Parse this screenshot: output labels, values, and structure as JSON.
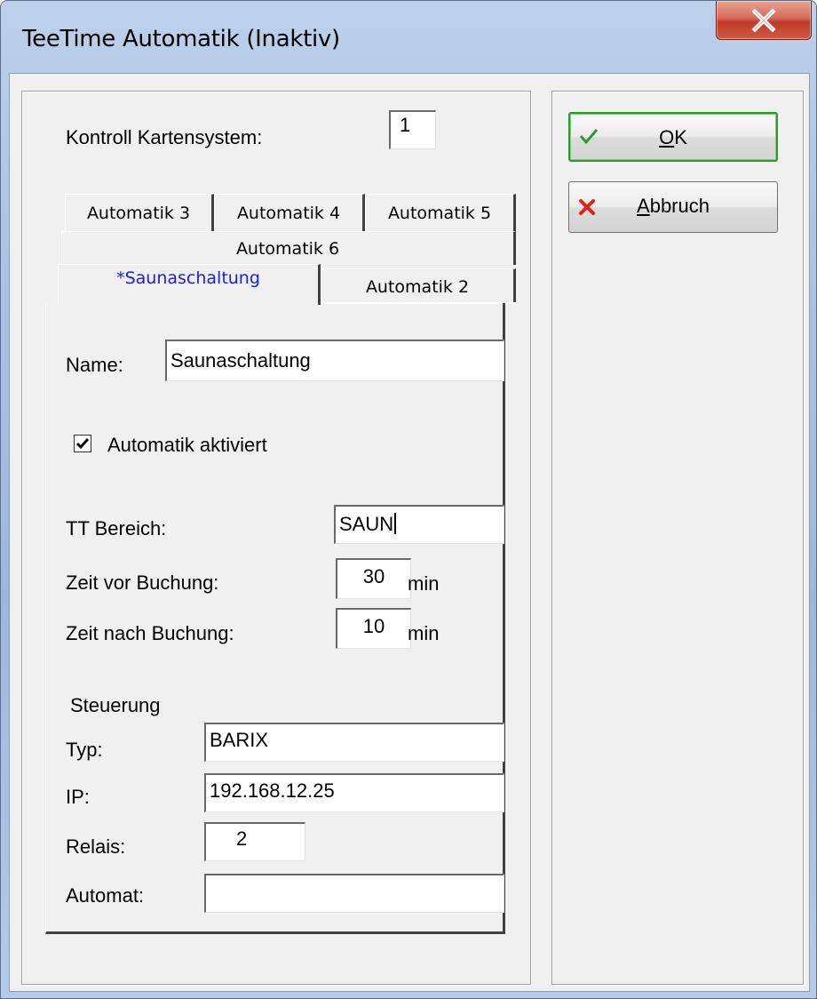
{
  "window": {
    "title": "TeeTime Automatik (Inaktiv)",
    "close_label": "X"
  },
  "kontroll": {
    "label": "Kontroll Kartensystem:",
    "value": "1"
  },
  "tabs": {
    "row1": [
      "Automatik 3",
      "Automatik 4",
      "Automatik 5"
    ],
    "row2": [
      "Automatik 6"
    ],
    "row3": [
      "*Saunaschaltung",
      "Automatik 2"
    ],
    "active": "*Saunaschaltung"
  },
  "form": {
    "name_label": "Name:",
    "name_value": "Saunaschaltung",
    "auto_active_label": "Automatik aktiviert",
    "auto_active_checked": true,
    "tt_bereich_label": "TT Bereich:",
    "tt_bereich_value": "SAUN",
    "zeit_vor_label": "Zeit vor Buchung:",
    "zeit_vor_value": "30",
    "zeit_nach_label": "Zeit nach Buchung:",
    "zeit_nach_value": "10",
    "unit_min": "min",
    "steuerung_label": "Steuerung",
    "typ_label": "Typ:",
    "typ_value": "BARIX",
    "ip_label": "IP:",
    "ip_value": "192.168.12.25",
    "relais_label": "Relais:",
    "relais_value": "2",
    "automat_label": "Automat:",
    "automat_value": ""
  },
  "buttons": {
    "ok_mnemonic": "O",
    "ok_rest": "K",
    "cancel_mnemonic": "A",
    "cancel_rest": "bbruch"
  },
  "colors": {
    "active_tab_text": "#1a1af0",
    "ok_border": "#2a9c2a",
    "check_icon": "#2a9c2a",
    "cancel_icon": "#e0231a"
  }
}
